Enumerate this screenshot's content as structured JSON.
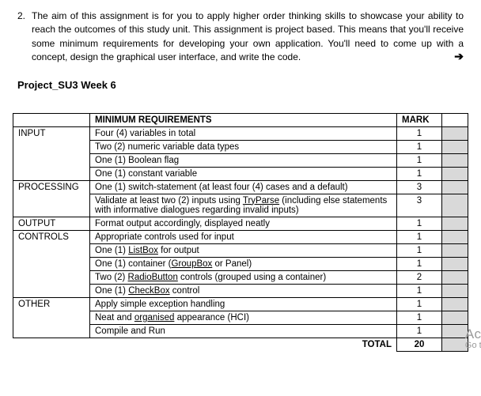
{
  "intro": {
    "number": "2.",
    "text": "The aim of this assignment is for you to apply higher order thinking skills to showcase your ability to reach the outcomes of this study unit. This assignment is project based.  This means that you'll receive some minimum requirements for developing your own application.  You'll need to come up with a concept, design the graphical user interface, and write the code."
  },
  "arrow_glyph": "➔",
  "project_title": "Project_SU3 Week 6",
  "headers": {
    "req": "MINIMUM REQUIREMENTS",
    "mark": "MARK"
  },
  "cats": {
    "input": "INPUT",
    "processing": "PROCESSING",
    "output": "OUTPUT",
    "controls": "CONTROLS",
    "other": "OTHER"
  },
  "rows": {
    "r1": "Four (4) variables in total",
    "r2": "Two (2) numeric variable data types",
    "r3": "One (1) Boolean flag",
    "r4": "One (1) constant variable",
    "r5": "One (1) switch-statement (at least four (4) cases and a default)",
    "r6a": "Validate at least two (2) inputs using ",
    "r6b": "TryParse",
    "r6c": " (including else statements with informative dialogues regarding invalid inputs)",
    "r7": "Format output accordingly, displayed neatly",
    "r8": "Appropriate controls used for input",
    "r9a": "One (1) ",
    "r9b": "ListBox",
    "r9c": " for output",
    "r10a": "One (1) container (",
    "r10b": "GroupBox",
    "r10c": " or Panel)",
    "r11a": "Two (2) ",
    "r11b": "RadioButton",
    "r11c": " controls (grouped using a container)",
    "r12a": "One (1) ",
    "r12b": "CheckBox",
    "r12c": " control",
    "r13": "Apply simple exception handling",
    "r14a": "Neat and ",
    "r14b": "organised",
    "r14c": " appearance (HCI)",
    "r15": "Compile and Run"
  },
  "marks": {
    "m1": "1",
    "m2": "1",
    "m3": "1",
    "m4": "1",
    "m5": "3",
    "m6": "3",
    "m7": "1",
    "m8": "1",
    "m9": "1",
    "m10": "1",
    "m11": "2",
    "m12": "1",
    "m13": "1",
    "m14": "1",
    "m15": "1"
  },
  "total": {
    "label": "TOTAL",
    "value": "20"
  },
  "watermark": {
    "line1": "Activa",
    "line2": "Go to Se"
  }
}
